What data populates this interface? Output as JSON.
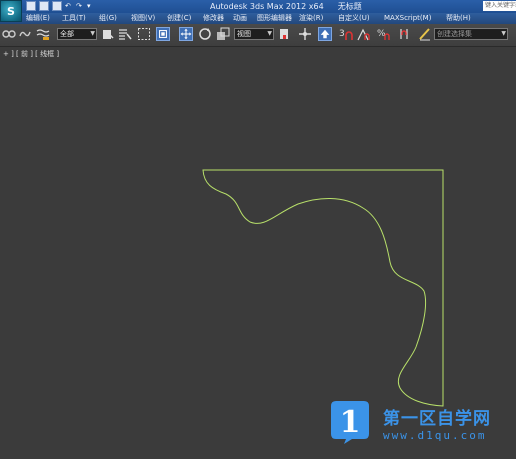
{
  "window": {
    "app_title": "Autodesk 3ds Max  2012 x64",
    "doc_title": "无标题",
    "search_placeholder": "键入关键字或短语",
    "logo_letter": "S"
  },
  "menu": {
    "items": [
      "编辑(E)",
      "工具(T)",
      "组(G)",
      "视图(V)",
      "创建(C)",
      "修改器",
      "动画",
      "图形编辑器",
      "渲染(R)",
      "自定义(U)",
      "MAXScript(M)",
      "帮助(H)"
    ]
  },
  "toolbar": {
    "selection_filter": "全部",
    "reference_coord": "视图",
    "named_selection_placeholder": "创建选择集"
  },
  "viewport": {
    "label": "+ ] [ 前 ] [ 线框 ]",
    "shape_color": "#b8e06a",
    "background": "#3b3b3b"
  },
  "watermark": {
    "logo_char": "1",
    "title": "第一区自学网",
    "url": "www.d1qu.com",
    "color": "#3b93e8"
  }
}
